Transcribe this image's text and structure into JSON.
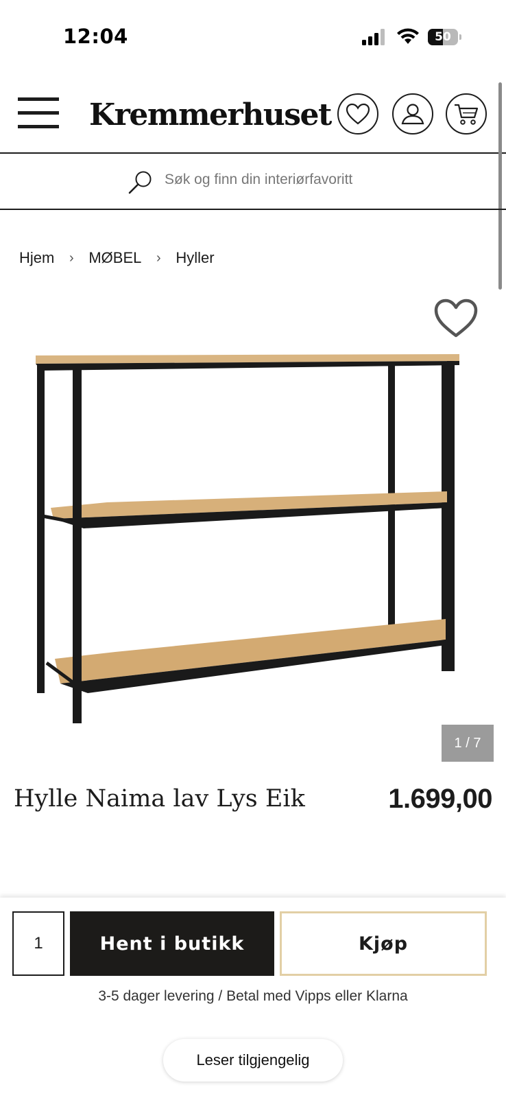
{
  "status_bar": {
    "time": "12:04",
    "battery_level": "50",
    "battery_fraction": 0.5,
    "icons": [
      "cellular-signal-icon",
      "wifi-icon",
      "battery-icon"
    ]
  },
  "header": {
    "logo": "Kremmerhuset",
    "icons": [
      "menu-icon",
      "heart-icon",
      "user-icon",
      "cart-icon"
    ]
  },
  "search": {
    "placeholder": "Søk og finn din interiørfavoritt"
  },
  "breadcrumb": {
    "items": [
      "Hjem",
      "MØBEL",
      "Hyller"
    ],
    "separator": "›"
  },
  "gallery": {
    "counter": "1 / 7",
    "current": 1,
    "total": 7
  },
  "product": {
    "title": "Hylle Naima lav Lys Eik",
    "price": "1.699,00"
  },
  "purchase": {
    "quantity": "1",
    "pickup_label": "Hent i butikk",
    "buy_label": "Kjøp",
    "delivery_note": "3-5 dager levering / Betal med Vipps eller Klarna"
  },
  "reader": {
    "label": "Leser tilgjengelig"
  },
  "colors": {
    "text": "#1c1c1c",
    "pickup_button": "#1c1b19",
    "buy_border": "#e2cfa5",
    "counter_bg": "#9b9b9b",
    "wood": "#d8b27e"
  }
}
